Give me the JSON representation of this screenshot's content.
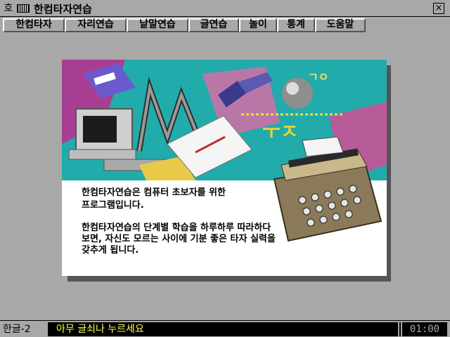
{
  "window": {
    "title": "한컴타자연습",
    "sys_icon": "호",
    "close_label": "×"
  },
  "menu": [
    {
      "label": "한컴타자"
    },
    {
      "label": "자리연습"
    },
    {
      "label": "낱말연습"
    },
    {
      "label": "글연습"
    },
    {
      "label": "놀이"
    },
    {
      "label": "통계"
    },
    {
      "label": "도움말"
    }
  ],
  "panel": {
    "line1": "한컴타자연습은 컴퓨터 초보자를 위한",
    "line2": "프로그램입니다.",
    "line3": "한컴타자연습의 단계별 학습을 하루하루 따라하다",
    "line4": "보면, 자신도 모르는 사이에 기분 좋은 타자 실력을",
    "line5": "갖추게 됩니다."
  },
  "status": {
    "mode": "한글-2",
    "message": "아무 글쇠나 누르세요",
    "time": "01:00"
  },
  "colors": {
    "background": "#a8a8a8",
    "status_text": "#ffff55",
    "art_teal": "#23b0b0"
  }
}
